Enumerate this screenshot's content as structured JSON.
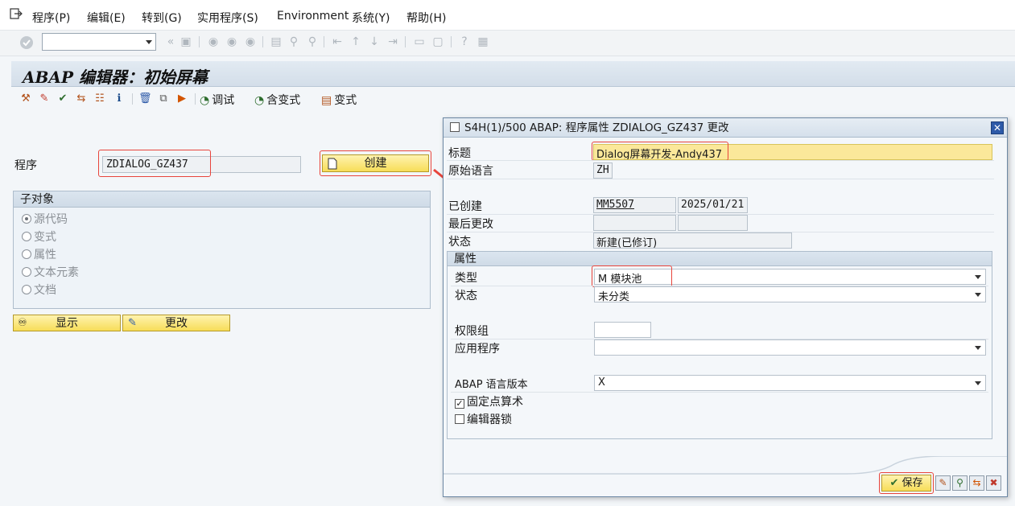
{
  "menu": {
    "items": [
      "程序(P)",
      "编辑(E)",
      "转到(G)",
      "实用程序(S)",
      "Environment",
      "系统(Y)",
      "帮助(H)"
    ]
  },
  "toolbar": {
    "command_value": ""
  },
  "title": "ABAP 编辑器：初始屏幕",
  "app_toolbar": {
    "debug_label": "调试",
    "with_variant_label": "含变式",
    "variant_label": "变式"
  },
  "main": {
    "program_label": "程序",
    "program_value": "ZDIALOG_GZ437",
    "create_label": "创建",
    "subobjects": {
      "title": "子对象",
      "options": [
        "源代码",
        "变式",
        "属性",
        "文本元素",
        "文档"
      ],
      "selected": "源代码"
    },
    "display_label": "显示",
    "change_label": "更改"
  },
  "dialog": {
    "title": "S4H(1)/500 ABAP: 程序属性 ZDIALOG_GZ437 更改",
    "labels": {
      "title": "标题",
      "orig_lang": "原始语言",
      "created": "已创建",
      "last_changed": "最后更改",
      "status": "状态"
    },
    "values": {
      "title": "Dialog屏幕开发-Andy437",
      "orig_lang": "ZH",
      "created_by": "MM5507",
      "created_on": "2025/01/21",
      "changed_by": "",
      "changed_on": "",
      "status": "新建(已修订)"
    },
    "attributes": {
      "group_title": "属性",
      "type_label": "类型",
      "type_value": "M 模块池",
      "status_label": "状态",
      "status_value": "未分类",
      "auth_group_label": "权限组",
      "auth_group_value": "",
      "application_label": "应用程序",
      "application_value": "",
      "abap_version_label": "ABAP 语言版本",
      "abap_version_value": "X",
      "fixed_point_label": "固定点算术",
      "fixed_point_checked": true,
      "editor_lock_label": "编辑器锁",
      "editor_lock_checked": false
    },
    "save_label": "保存"
  },
  "colors": {
    "highlight_red": "#e8453c",
    "button_yellow": "#f7dd58",
    "title_bg": "#d3dee9"
  }
}
